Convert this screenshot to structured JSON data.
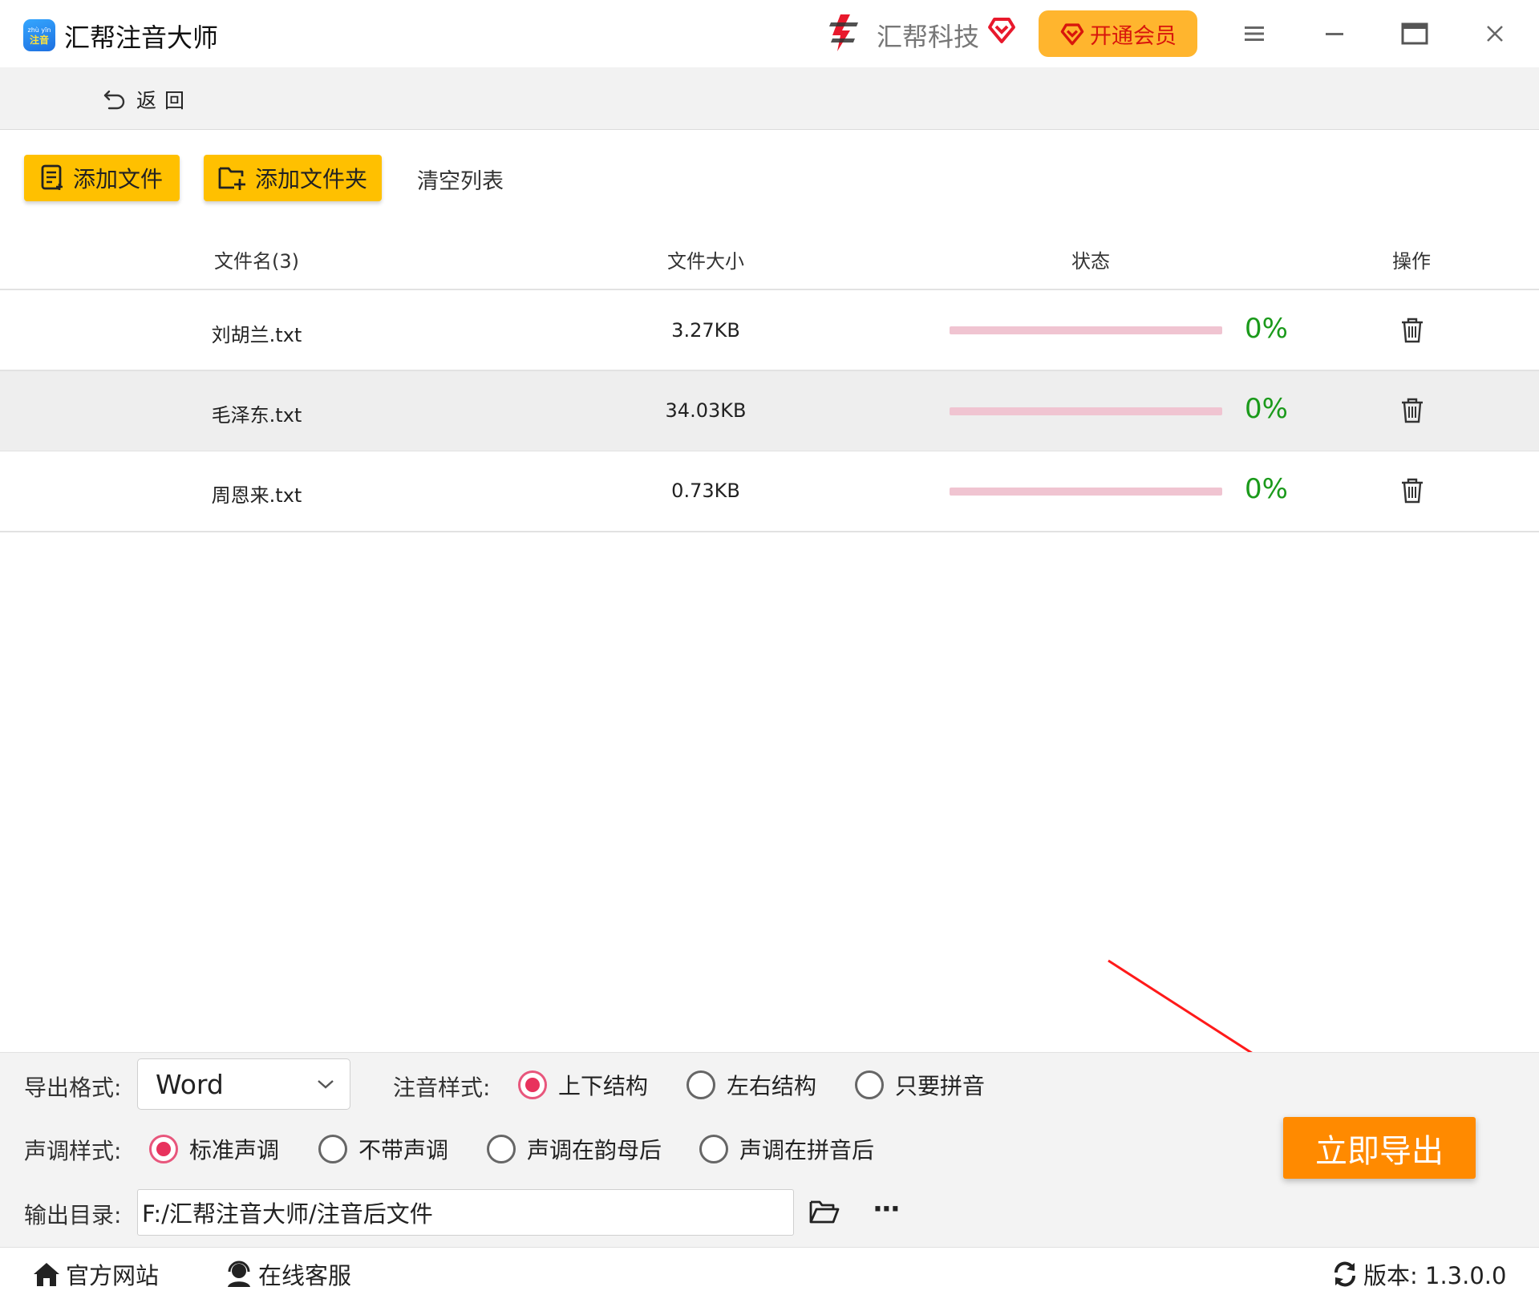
{
  "app": {
    "title": "汇帮注音大师",
    "logo_top": "zhù yīn",
    "logo_text": "注音"
  },
  "brand": {
    "name": "汇帮科技"
  },
  "header": {
    "vip_label": "开通会员"
  },
  "nav": {
    "back_label": "返回"
  },
  "toolbar": {
    "add_file": "添加文件",
    "add_folder": "添加文件夹",
    "clear_list": "清空列表"
  },
  "table": {
    "headers": [
      "文件名(3)",
      "文件大小",
      "状态",
      "操作"
    ],
    "rows": [
      {
        "name": "刘胡兰.txt",
        "size": "3.27KB",
        "progress": 0,
        "progress_label": "0%"
      },
      {
        "name": "毛泽东.txt",
        "size": "34.03KB",
        "progress": 0,
        "progress_label": "0%"
      },
      {
        "name": "周恩来.txt",
        "size": "0.73KB",
        "progress": 0,
        "progress_label": "0%"
      }
    ]
  },
  "settings": {
    "format_label": "导出格式:",
    "format_value": "Word",
    "style_label": "注音样式:",
    "style_options": [
      "上下结构",
      "左右结构",
      "只要拼音"
    ],
    "style_selected": 0,
    "tone_label": "声调样式:",
    "tone_options": [
      "标准声调",
      "不带声调",
      "声调在韵母后",
      "声调在拼音后"
    ],
    "tone_selected": 0,
    "output_label": "输出目录:",
    "output_path": "F:/汇帮注音大师/注音后文件",
    "more_label": "···"
  },
  "actions": {
    "export": "立即导出"
  },
  "statusbar": {
    "website": "官方网站",
    "support": "在线客服",
    "version": "版本: 1.3.0.0"
  },
  "colors": {
    "accent": "#ffc000",
    "export": "#ff8a00",
    "progress": "#f0c4d1",
    "percent": "#1b9a1b",
    "radio": "#e8325d"
  }
}
